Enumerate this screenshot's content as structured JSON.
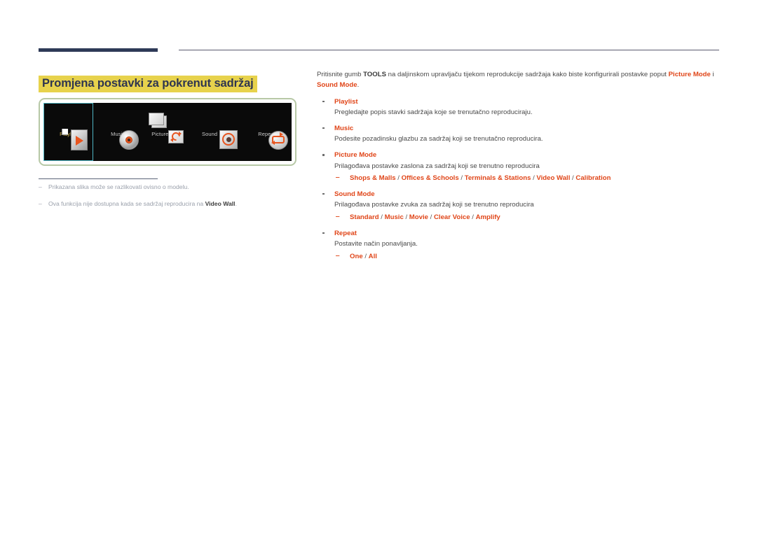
{
  "page": {
    "title": "Promjena postavki za pokrenut sadržaj"
  },
  "figure": {
    "items": [
      {
        "label": "Playlist",
        "icon": "playlist-icon",
        "selected": true
      },
      {
        "label": "Music",
        "icon": "music-disc-icon",
        "selected": false
      },
      {
        "label": "Picture Mode",
        "icon": "picture-mode-icon",
        "selected": false
      },
      {
        "label": "Sound Mode",
        "icon": "sound-mode-icon",
        "selected": false
      },
      {
        "label": "Repeat",
        "icon": "repeat-icon",
        "selected": false
      }
    ]
  },
  "notes": [
    {
      "dash": "‒",
      "text_before": "Prikazana slika može se razlikovati ovisno o modelu.",
      "bold": "",
      "text_after": ""
    },
    {
      "dash": "‒",
      "text_before": "Ova funkcija nije dostupna kada se sadržaj reproducira na ",
      "bold": "Video Wall",
      "text_after": "."
    }
  ],
  "intro": {
    "p1_a": "Pritisnite gumb ",
    "p1_bold": "TOOLS",
    "p1_b": " na daljinskom upravljaču tijekom reprodukcije sadržaja kako biste konfigurirali postavke poput ",
    "p1_hl1": "Picture Mode",
    "p1_c": " i ",
    "p1_hl2": "Sound Mode",
    "p1_d": "."
  },
  "bullets": [
    {
      "term": "Playlist",
      "desc": "Pregledajte popis stavki sadržaja koje se trenutačno reproduciraju.",
      "sub": null
    },
    {
      "term": "Music",
      "desc": "Podesite pozadinsku glazbu za sadržaj koji se trenutačno reproducira.",
      "sub": null
    },
    {
      "term": "Picture Mode",
      "desc": "Prilagođava postavke zaslona za sadržaj koji se trenutno reproducira",
      "sub": {
        "dash": "‒",
        "options": [
          "Shops & Malls",
          "Offices & Schools",
          "Terminals & Stations",
          "Video Wall",
          "Calibration"
        ],
        "separator": " / "
      }
    },
    {
      "term": "Sound Mode",
      "desc": "Prilagođava postavke zvuka za sadržaj koji se trenutno reproducira",
      "sub": {
        "dash": "‒",
        "options": [
          "Standard",
          "Music",
          "Movie",
          "Clear Voice",
          "Amplify"
        ],
        "separator": " / "
      }
    },
    {
      "term": "Repeat",
      "desc": "Postavite način ponavljanja.",
      "sub": {
        "dash": "‒",
        "options": [
          "One",
          "All"
        ],
        "separator": " / "
      }
    }
  ],
  "colors": {
    "accent_red": "#e04518",
    "title_highlight": "#e7d24c",
    "title_text": "#2e3550",
    "rule_navy": "#2e3a57",
    "frame_green": "#b7c8a6",
    "selection_teal": "#4fb6c4"
  }
}
